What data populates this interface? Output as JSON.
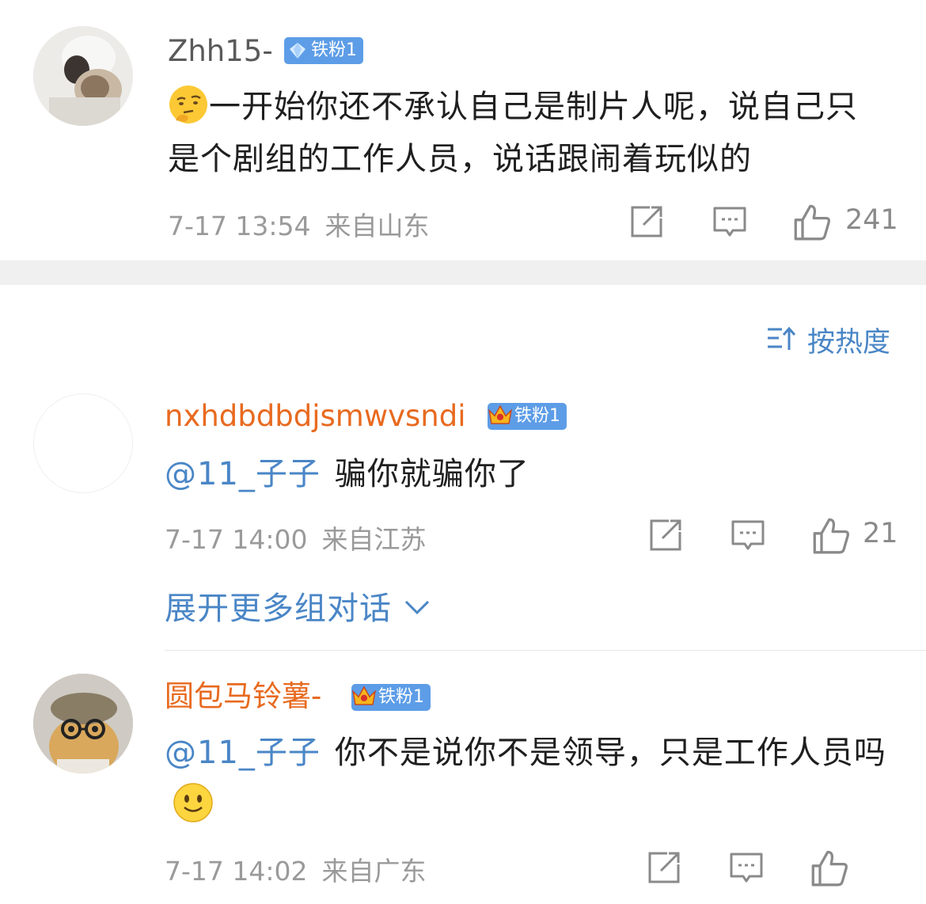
{
  "comments": [
    {
      "username": "Zhh15-",
      "badge": "铁粉1",
      "text": "一开始你还不承认自己是制片人呢，说自己只是个剧组的工作人员，说话跟闹着玩似的",
      "time": "7-17 13:54",
      "location": "来自山东",
      "likes": "241"
    },
    {
      "username": "nxhdbdbdjsmwvsndi",
      "badge": "铁粉1",
      "mention": "@11_子子",
      "text": "骗你就骗你了",
      "time": "7-17 14:00",
      "location": "来自江苏",
      "likes": "21"
    },
    {
      "username": "圆包马铃薯-",
      "badge": "铁粉1",
      "mention": "@11_子子",
      "text": "你不是说你不是领导，只是工作人员吗",
      "time": "7-17 14:02",
      "location": "来自广东"
    }
  ],
  "sort_label": "按热度",
  "expand_label": "展开更多组对话",
  "colors": {
    "username_vip": "#e86a1f",
    "username_normal": "#5a5a5a",
    "link": "#4a86c6",
    "badge": "#5d9de7",
    "meta": "#9a9a9a",
    "divider": "#f0f0f0"
  },
  "icons": [
    "share-icon",
    "reply-icon",
    "like-icon",
    "sort-icon",
    "chevron-down-icon",
    "diamond-icon",
    "crown-icon",
    "thinking-emoji",
    "smile-emoji"
  ]
}
